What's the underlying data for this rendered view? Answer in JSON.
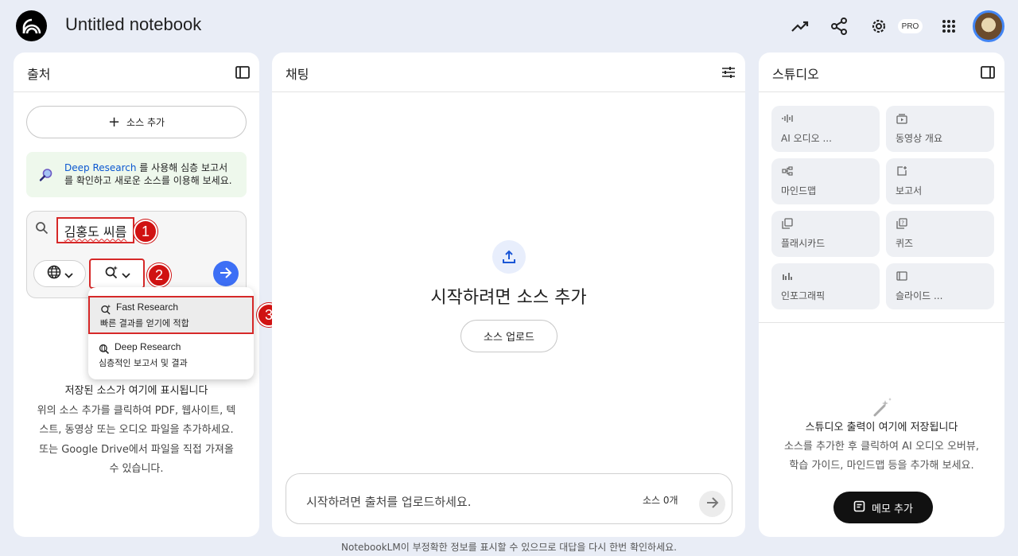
{
  "app": {
    "notebook_title": "Untitled notebook",
    "pro_badge": "PRO"
  },
  "sources_panel": {
    "title": "출처",
    "add_source_label": "소스 추가",
    "deep_research_banner": {
      "link_text": "Deep Research",
      "line1_rest": " 를 사용해 심층 보고서",
      "line2": "를 확인하고 새로운 소스를 이용해 보세요."
    },
    "search": {
      "query": "김홍도 씨름"
    },
    "dropdown": {
      "items": [
        {
          "title": "Fast Research",
          "subtitle": "빠른 결과를 얻기에 적합"
        },
        {
          "title": "Deep Research",
          "subtitle": "심층적인 보고서 및 결과"
        }
      ]
    },
    "empty_state": {
      "title": "저장된 소스가 여기에 표시됩니다",
      "line1": "위의 소스 추가를 클릭하여 PDF, 웹사이트, 텍",
      "line2": "스트, 동영상 또는 오디오 파일을 추가하세요.",
      "line3": "또는 Google Drive에서 파일을 직접 가져올",
      "line4": "수 있습니다."
    },
    "markers": [
      "1",
      "2",
      "3"
    ]
  },
  "chat_panel": {
    "title": "채팅",
    "heading": "시작하려면 소스 추가",
    "upload_label": "소스 업로드",
    "input_placeholder": "시작하려면 출처를 업로드하세요.",
    "source_count": "소스 0개"
  },
  "studio_panel": {
    "title": "스튜디오",
    "tiles": [
      {
        "label": "AI 오디오 ...",
        "icon": "audio-waveform-icon"
      },
      {
        "label": "동영상 개요",
        "icon": "video-overview-icon"
      },
      {
        "label": "마인드맵",
        "icon": "mindmap-icon"
      },
      {
        "label": "보고서",
        "icon": "report-icon"
      },
      {
        "label": "플래시카드",
        "icon": "flashcards-icon"
      },
      {
        "label": "퀴즈",
        "icon": "quiz-icon"
      },
      {
        "label": "인포그래픽",
        "icon": "infographic-icon"
      },
      {
        "label": "슬라이드 ...",
        "icon": "slides-icon"
      }
    ],
    "empty_state": {
      "title": "스튜디오 출력이 여기에 저장됩니다",
      "line1": "소스를 추가한 후 클릭하여 AI 오디오 오버뷰,",
      "line2": "학습 가이드, 마인드맵 등을 추가해 보세요."
    },
    "memo_button": "메모 추가"
  },
  "footer": {
    "disclaimer": "NotebookLM이 부정확한 정보를 표시할 수 있으므로 대답을 다시 한번 확인하세요."
  },
  "colors": {
    "background": "#e9edf6",
    "accent_blue": "#3d6ff5",
    "annotation_red": "#d62828"
  }
}
